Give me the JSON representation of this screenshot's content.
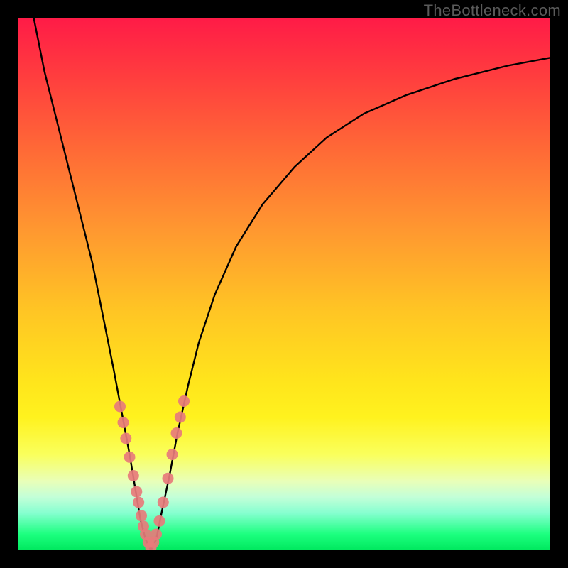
{
  "watermark": "TheBottleneck.com",
  "chart_data": {
    "type": "line",
    "title": "",
    "xlabel": "",
    "ylabel": "",
    "xlim": [
      0,
      100
    ],
    "ylim": [
      0,
      100
    ],
    "series": [
      {
        "name": "bottleneck-curve",
        "x": [
          3,
          5,
          8,
          11,
          14,
          16,
          18,
          19.5,
          21,
          22,
          23,
          24,
          25,
          26,
          27,
          28.5,
          30,
          32,
          34,
          37,
          41,
          46,
          52,
          58,
          65,
          73,
          82,
          92,
          100
        ],
        "y": [
          100,
          90,
          78,
          66,
          54,
          44,
          34,
          26,
          18,
          12,
          6,
          2,
          0,
          2,
          7,
          14,
          22,
          31,
          39,
          48,
          57,
          65,
          72,
          77.5,
          82,
          85.5,
          88.5,
          91,
          92.5
        ]
      }
    ],
    "highlight_clusters": [
      {
        "name": "left-branch-dots",
        "points": [
          {
            "x": 19.2,
            "y": 27
          },
          {
            "x": 19.8,
            "y": 24
          },
          {
            "x": 20.3,
            "y": 21
          },
          {
            "x": 21.0,
            "y": 17.5
          },
          {
            "x": 21.7,
            "y": 14
          },
          {
            "x": 22.3,
            "y": 11
          },
          {
            "x": 22.7,
            "y": 9
          },
          {
            "x": 23.2,
            "y": 6.5
          },
          {
            "x": 23.6,
            "y": 4.5
          },
          {
            "x": 24.0,
            "y": 3
          },
          {
            "x": 24.5,
            "y": 1.5
          }
        ]
      },
      {
        "name": "right-branch-dots",
        "points": [
          {
            "x": 25.0,
            "y": 0.5
          },
          {
            "x": 25.5,
            "y": 1.5
          },
          {
            "x": 26.0,
            "y": 3
          },
          {
            "x": 26.6,
            "y": 5.5
          },
          {
            "x": 27.3,
            "y": 9
          },
          {
            "x": 28.2,
            "y": 13.5
          },
          {
            "x": 29.0,
            "y": 18
          },
          {
            "x": 29.8,
            "y": 22
          },
          {
            "x": 30.5,
            "y": 25
          },
          {
            "x": 31.2,
            "y": 28
          }
        ]
      }
    ],
    "gradient_stops": [
      {
        "pos": 0,
        "color": "#ff1b47"
      },
      {
        "pos": 25,
        "color": "#ff6a36"
      },
      {
        "pos": 55,
        "color": "#ffc524"
      },
      {
        "pos": 75,
        "color": "#fff21e"
      },
      {
        "pos": 90,
        "color": "#c3ffd8"
      },
      {
        "pos": 100,
        "color": "#00e85e"
      }
    ],
    "dot_color": "#e77b7b",
    "curve_color": "#000000"
  }
}
